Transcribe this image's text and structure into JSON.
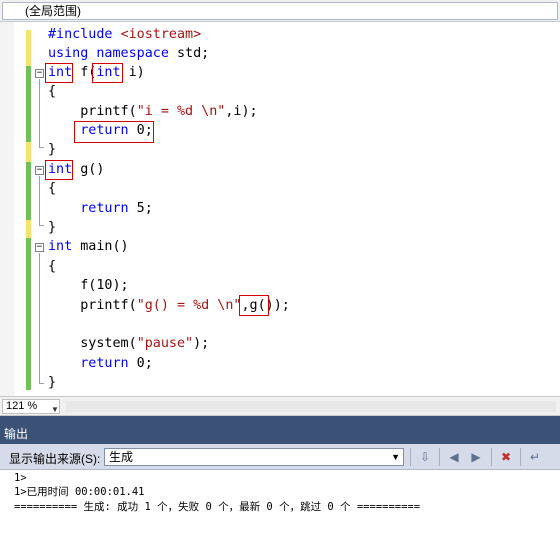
{
  "scope": {
    "label": "(全局范围)"
  },
  "code": {
    "l1": {
      "kw": "#include ",
      "str": "<iostream>"
    },
    "l2": {
      "kw1": "using",
      "sp1": " ",
      "kw2": "namespace",
      "rest": " std;"
    },
    "l3": {
      "kw1": "int",
      "mid": " f(",
      "kw2": "int",
      "rest": " i)"
    },
    "l4": "{",
    "l5": {
      "pre": "    printf(",
      "str": "\"i = %d \\n\"",
      "rest": ",i);"
    },
    "l6": {
      "pre": "    ",
      "kw": "return",
      "rest": " 0;"
    },
    "l7": "}",
    "l8": {
      "kw": "int",
      "rest": " g()"
    },
    "l9": "{",
    "l10": {
      "pre": "    ",
      "kw": "return",
      "rest": " 5;"
    },
    "l11": "}",
    "l12": {
      "kw": "int",
      "rest": " main()"
    },
    "l13": "{",
    "l14": "    f(10);",
    "l15": {
      "pre": "    printf(",
      "str": "\"g() = %d \\n\"",
      "rest": ",g());"
    },
    "l16": "",
    "l17": {
      "pre": "    system(",
      "str": "\"pause\"",
      "rest": ");"
    },
    "l18": {
      "pre": "    ",
      "kw": "return",
      "rest": " 0;"
    },
    "l19": "}"
  },
  "zoom": {
    "value": "121 %"
  },
  "output": {
    "title": "输出",
    "source_label": "显示输出来源(S):",
    "source_value": "生成",
    "lines": [
      "1>",
      "1>已用时间 00:00:01.41",
      "========== 生成: 成功 1 个，失败 0 个，最新 0 个，跳过 0 个 =========="
    ]
  },
  "colors": {
    "keyword": "#0000ff",
    "string": "#a31515",
    "highlight": "#d40000",
    "panel": "#3b5276"
  }
}
